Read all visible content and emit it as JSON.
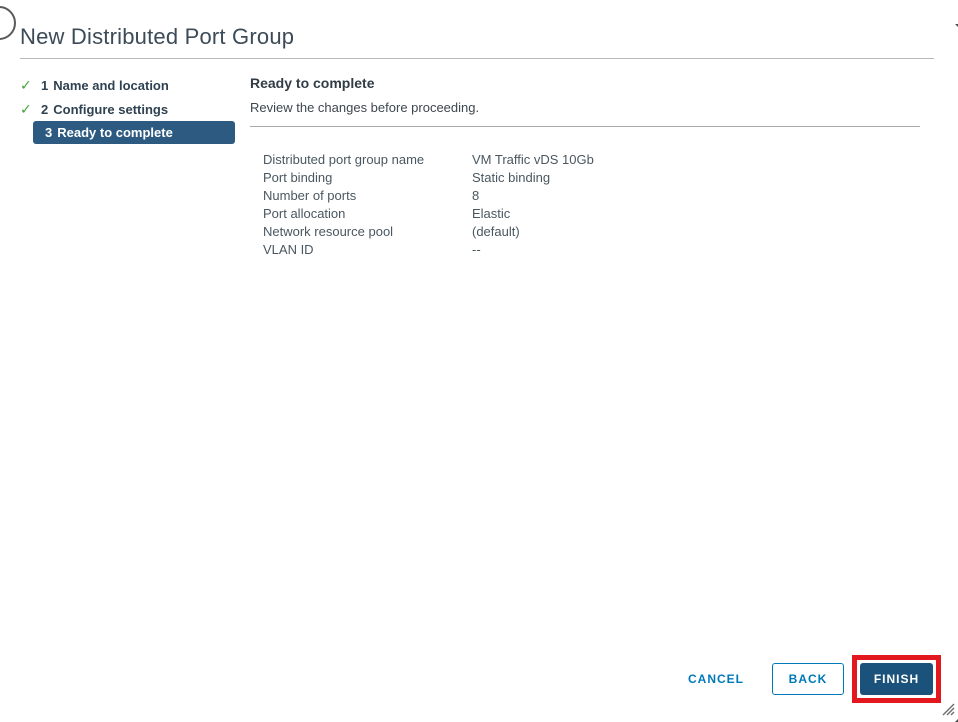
{
  "dialog": {
    "title": "New Distributed Port Group"
  },
  "wizard_steps": [
    {
      "number": "1",
      "label": "Name and location",
      "completed": true,
      "active": false
    },
    {
      "number": "2",
      "label": "Configure settings",
      "completed": true,
      "active": false
    },
    {
      "number": "3",
      "label": "Ready to complete",
      "completed": false,
      "active": true
    }
  ],
  "panel": {
    "heading": "Ready to complete",
    "subheading": "Review the changes before proceeding."
  },
  "summary": {
    "rows": [
      {
        "label": "Distributed port group name",
        "value": "VM Traffic vDS 10Gb"
      },
      {
        "label": "Port binding",
        "value": "Static binding"
      },
      {
        "label": "Number of ports",
        "value": "8"
      },
      {
        "label": "Port allocation",
        "value": "Elastic"
      },
      {
        "label": "Network resource pool",
        "value": "(default)"
      },
      {
        "label": "VLAN ID",
        "value": "--"
      }
    ]
  },
  "footer": {
    "cancel": "CANCEL",
    "back": "BACK",
    "finish": "FINISH"
  },
  "icons": {
    "completed_step": "check-icon",
    "resize": "resize-grip-icon"
  },
  "annotation": {
    "type": "highlight-box",
    "highlighted_element": "finish-button",
    "color": "#e3181f"
  },
  "colors": {
    "active_step_bg": "#2c5a80",
    "finish_button_bg": "#1a527b",
    "link_blue": "#0079b8",
    "check_green": "#41a33e",
    "divider_gray": "#b0b0b0",
    "text_dark": "#3c4b57"
  }
}
